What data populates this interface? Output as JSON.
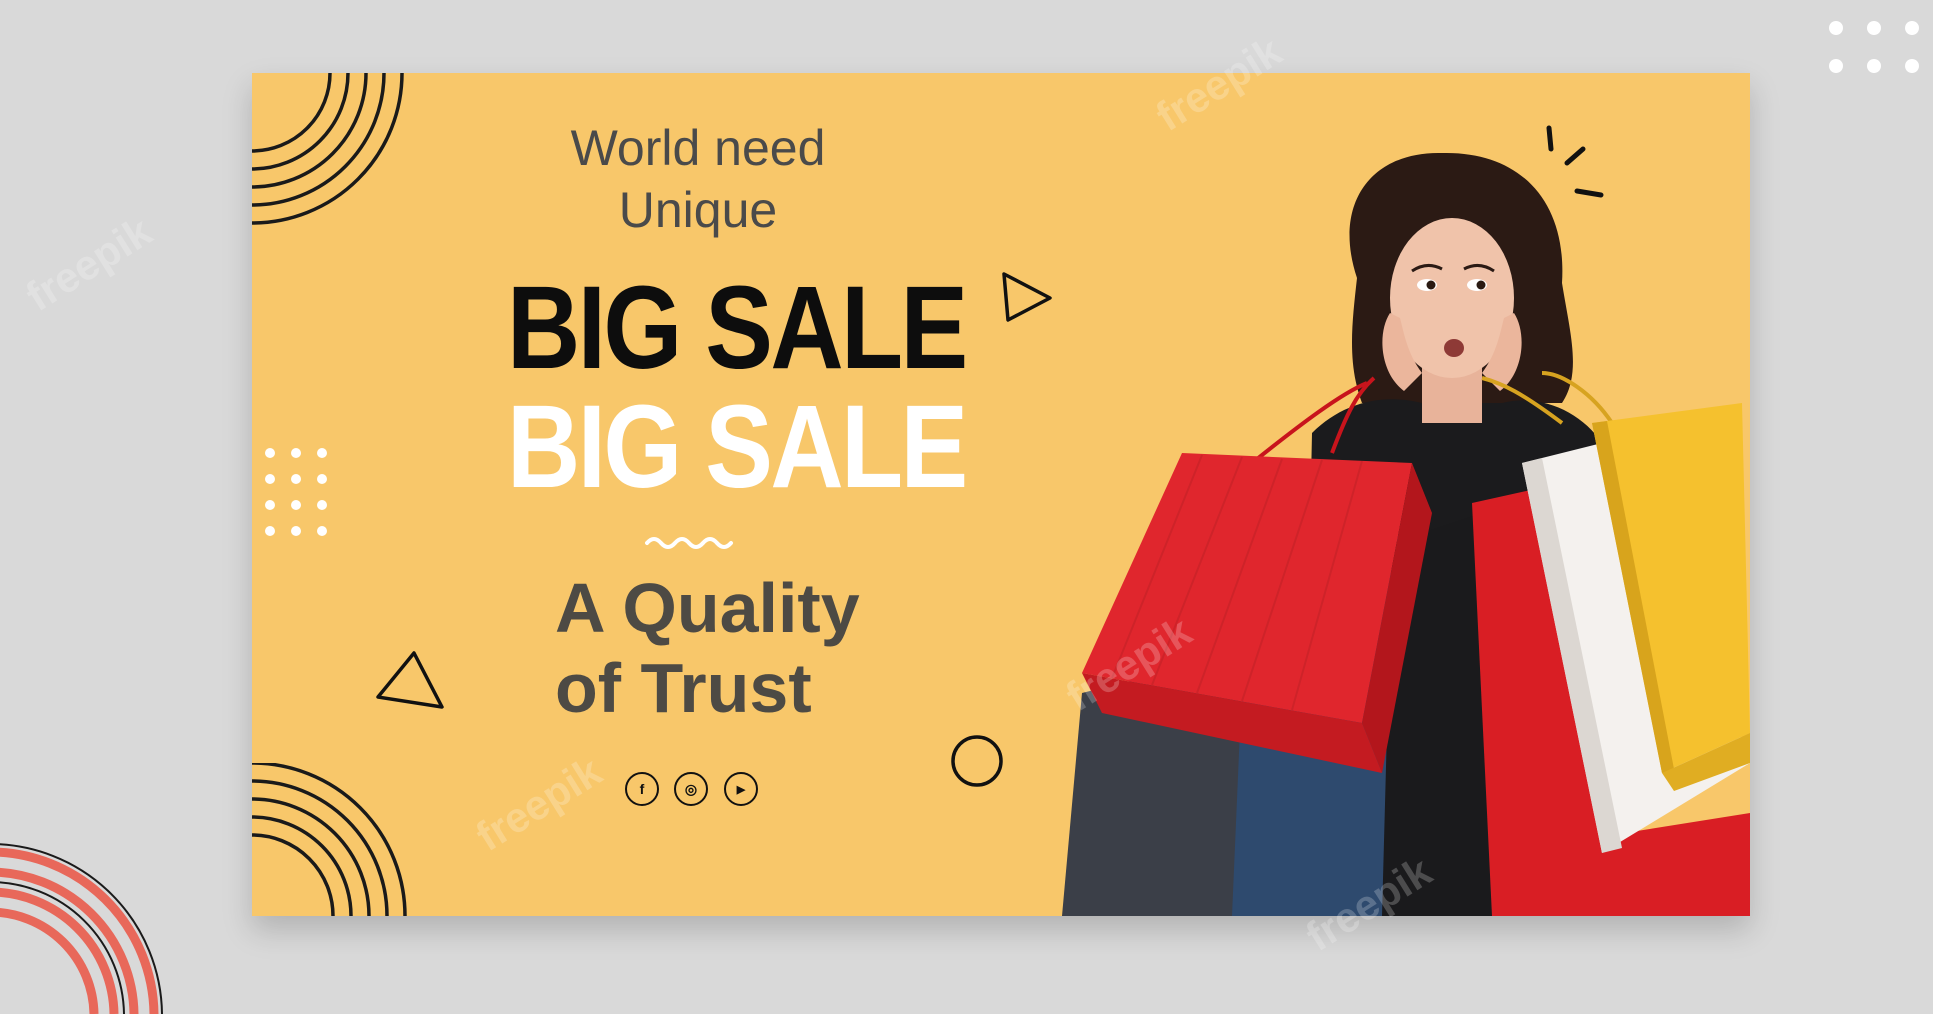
{
  "banner": {
    "tagline_line1": "World need",
    "tagline_line2": "Unique",
    "headline_dark": "BIG SALE",
    "headline_light": "BIG SALE",
    "quality_line1": "A Quality",
    "quality_line2": "of Trust",
    "social_icons": [
      "facebook-icon",
      "instagram-icon",
      "youtube-icon"
    ],
    "social_glyphs": {
      "facebook": "f",
      "instagram": "◎",
      "youtube": "▶"
    }
  },
  "watermark": "freepik",
  "colors": {
    "page_background": "#d9d9d9",
    "banner_background": "#f8c76a",
    "headline_dark": "#0d0d0d",
    "headline_light": "#ffffff",
    "text_gray": "#4a4a4a",
    "accent_coral": "#e8685a",
    "bag_red": "#e0262d",
    "bag_yellow": "#f5c12e",
    "bag_navy": "#2e4a6e",
    "bag_dark": "#3b3f48"
  }
}
